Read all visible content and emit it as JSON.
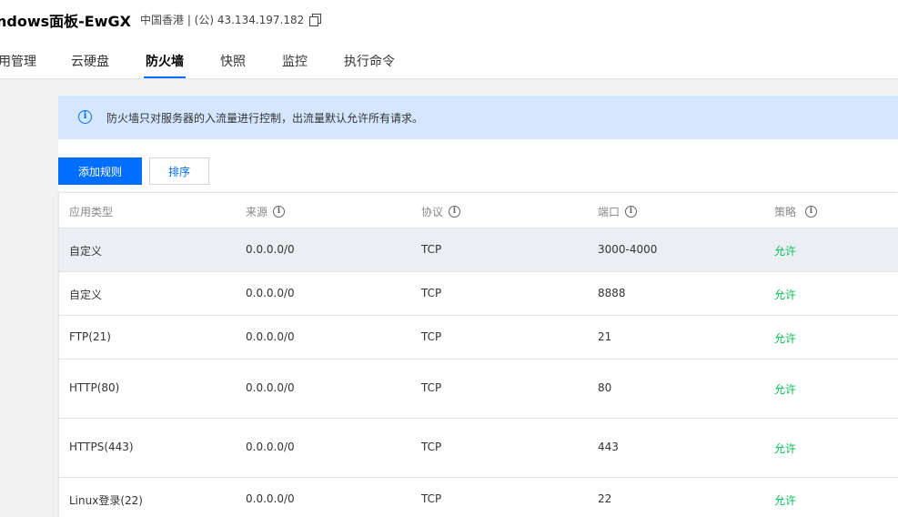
{
  "header": {
    "title": "ndows面板-EwGX",
    "region": "中国香港 | (公) 43.134.197.182"
  },
  "tabs": [
    {
      "label": "用管理"
    },
    {
      "label": "云硬盘"
    },
    {
      "label": "防火墙"
    },
    {
      "label": "快照"
    },
    {
      "label": "监控"
    },
    {
      "label": "执行命令"
    }
  ],
  "notice": {
    "text": "防火墙只对服务器的入流量进行控制，出流量默认允许所有请求。"
  },
  "toolbar": {
    "add_label": "添加规则",
    "sort_label": "排序"
  },
  "table": {
    "columns": [
      "应用类型",
      "来源",
      "协议",
      "端口",
      "策略"
    ],
    "rows": [
      {
        "type": "自定义",
        "source": "0.0.0.0/0",
        "protocol": "TCP",
        "port": "3000-4000",
        "policy": "允许"
      },
      {
        "type": "自定义",
        "source": "0.0.0.0/0",
        "protocol": "TCP",
        "port": "8888",
        "policy": "允许"
      },
      {
        "type": "FTP(21)",
        "source": "0.0.0.0/0",
        "protocol": "TCP",
        "port": "21",
        "policy": "允许"
      },
      {
        "type": "HTTP(80)",
        "source": "0.0.0.0/0",
        "protocol": "TCP",
        "port": "80",
        "policy": "允许"
      },
      {
        "type": "HTTPS(443)",
        "source": "0.0.0.0/0",
        "protocol": "TCP",
        "port": "443",
        "policy": "允许"
      },
      {
        "type": "Linux登录(22)",
        "source": "0.0.0.0/0",
        "protocol": "TCP",
        "port": "22",
        "policy": "允许"
      }
    ]
  },
  "colors": {
    "primary": "#006eff",
    "allow": "#0abf5b",
    "notice_bg": "#d5e7ff"
  },
  "icons": {
    "copy": "copy-icon",
    "info": "info-icon",
    "column_help": "help-circle-icon"
  }
}
